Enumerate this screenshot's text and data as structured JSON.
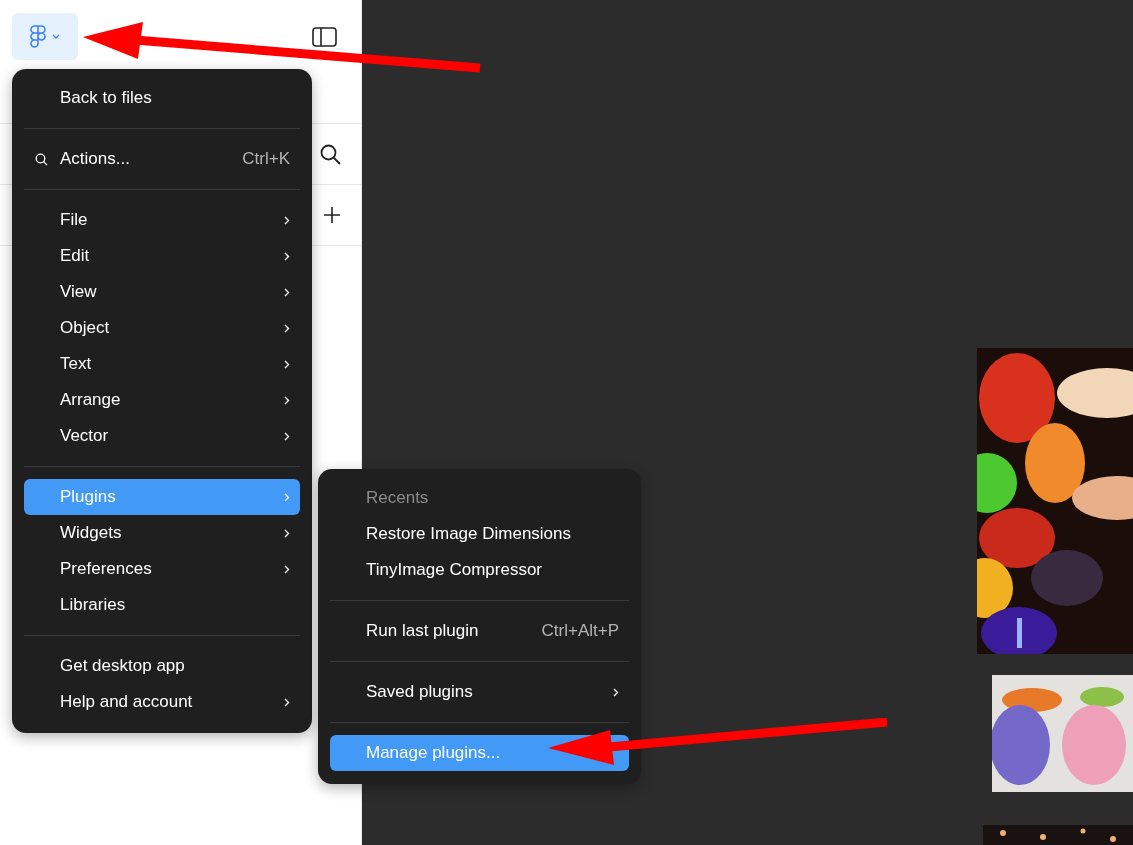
{
  "main_menu": {
    "groups": [
      {
        "items": [
          {
            "kind": "item",
            "label": "Back to files",
            "has_submenu": false,
            "selected": false
          }
        ]
      },
      {
        "items": [
          {
            "kind": "search",
            "label": "Actions...",
            "shortcut": "Ctrl+K",
            "has_submenu": false,
            "selected": false
          }
        ]
      },
      {
        "items": [
          {
            "kind": "item",
            "label": "File",
            "has_submenu": true,
            "selected": false
          },
          {
            "kind": "item",
            "label": "Edit",
            "has_submenu": true,
            "selected": false
          },
          {
            "kind": "item",
            "label": "View",
            "has_submenu": true,
            "selected": false
          },
          {
            "kind": "item",
            "label": "Object",
            "has_submenu": true,
            "selected": false
          },
          {
            "kind": "item",
            "label": "Text",
            "has_submenu": true,
            "selected": false
          },
          {
            "kind": "item",
            "label": "Arrange",
            "has_submenu": true,
            "selected": false
          },
          {
            "kind": "item",
            "label": "Vector",
            "has_submenu": true,
            "selected": false
          }
        ]
      },
      {
        "items": [
          {
            "kind": "item",
            "label": "Plugins",
            "has_submenu": true,
            "selected": true
          },
          {
            "kind": "item",
            "label": "Widgets",
            "has_submenu": true,
            "selected": false
          },
          {
            "kind": "item",
            "label": "Preferences",
            "has_submenu": true,
            "selected": false
          },
          {
            "kind": "item",
            "label": "Libraries",
            "has_submenu": false,
            "selected": false
          }
        ]
      },
      {
        "items": [
          {
            "kind": "item",
            "label": "Get desktop app",
            "has_submenu": false,
            "selected": false
          },
          {
            "kind": "item",
            "label": "Help and account",
            "has_submenu": true,
            "selected": false
          }
        ]
      }
    ]
  },
  "plugins_submenu": {
    "groups": [
      {
        "items": [
          {
            "kind": "heading",
            "label": "Recents"
          },
          {
            "kind": "item",
            "label": "Restore Image Dimensions",
            "has_submenu": false,
            "selected": false
          },
          {
            "kind": "item",
            "label": "TinyImage Compressor",
            "has_submenu": false,
            "selected": false
          }
        ]
      },
      {
        "items": [
          {
            "kind": "item",
            "label": "Run last plugin",
            "shortcut": "Ctrl+Alt+P",
            "has_submenu": false,
            "selected": false
          }
        ]
      },
      {
        "items": [
          {
            "kind": "item",
            "label": "Saved plugins",
            "has_submenu": true,
            "selected": false
          }
        ]
      },
      {
        "items": [
          {
            "kind": "item",
            "label": "Manage plugins...",
            "has_submenu": false,
            "selected": true
          }
        ]
      }
    ]
  }
}
